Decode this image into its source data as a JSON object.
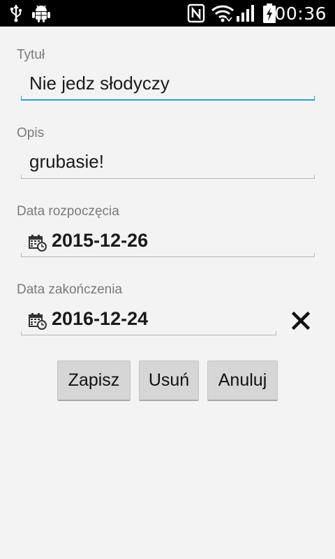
{
  "status_bar": {
    "time": "00:36",
    "icons": [
      "usb-icon",
      "android-debug-icon",
      "nfc-icon",
      "wifi-icon",
      "signal-icon",
      "battery-charging-icon"
    ]
  },
  "form": {
    "title_label": "Tytuł",
    "title_value": "Nie jedz słodyczy",
    "description_label": "Opis",
    "description_value": "grubasie!",
    "start_date_label": "Data rozpoczęcia",
    "start_date_value": "2015-12-26",
    "end_date_label": "Data zakończenia",
    "end_date_value": "2016-12-24"
  },
  "buttons": {
    "save": "Zapisz",
    "delete": "Usuń",
    "cancel": "Anuluj"
  },
  "colors": {
    "accent": "#29a3c7",
    "background": "#f3f3f3",
    "status_bar": "#000000",
    "button": "#d6d6d6"
  }
}
